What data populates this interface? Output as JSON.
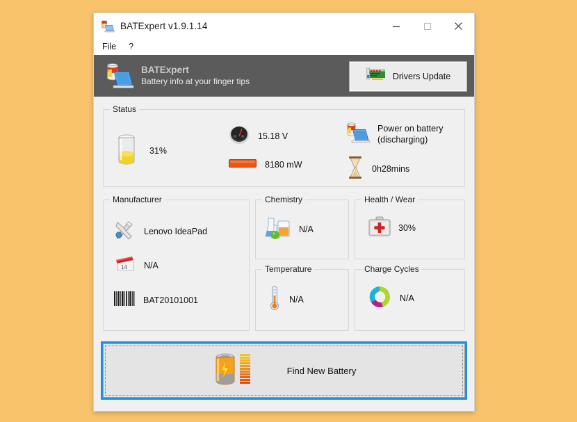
{
  "window": {
    "title": "BATExpert v1.9.1.14",
    "app_icon": "battery-laptop-icon",
    "controls": {
      "minimize": "minimize-icon",
      "maximize": "maximize-icon",
      "close": "close-icon"
    }
  },
  "menu": {
    "items": [
      {
        "label": "File"
      },
      {
        "label": "?"
      }
    ]
  },
  "banner": {
    "icon": "battery-laptop-icon",
    "title": "BATExpert",
    "subtitle": "Battery info at your finger tips",
    "button": {
      "label": "Drivers Update",
      "icon": "pci-card-icon"
    },
    "background": "#5b5b5b"
  },
  "status": {
    "legend": "Status",
    "charge": {
      "icon": "battery-cell-icon",
      "value": "31%"
    },
    "voltage": {
      "icon": "gauge-icon",
      "value": "15.18 V"
    },
    "power": {
      "icon": "orange-bar-icon",
      "value": "8180 mW"
    },
    "power_source": {
      "icon": "laptop-battery-icon",
      "value": "Power on battery\n(discharging)"
    },
    "time_left": {
      "icon": "hourglass-icon",
      "value": "0h28mins"
    }
  },
  "manufacturer": {
    "legend": "Manufacturer",
    "name": {
      "icon": "tools-icon",
      "value": "Lenovo IdeaPad"
    },
    "date": {
      "icon": "calendar-icon",
      "value": "N/A"
    },
    "serial": {
      "icon": "barcode-icon",
      "value": "BAT20101001"
    }
  },
  "chemistry": {
    "legend": "Chemistry",
    "icon": "beakers-icon",
    "value": "N/A"
  },
  "health": {
    "legend": "Health / Wear",
    "icon": "first-aid-kit-icon",
    "value": "30%"
  },
  "temperature": {
    "legend": "Temperature",
    "icon": "thermometer-icon",
    "value": "N/A"
  },
  "cycles": {
    "legend": "Charge Cycles",
    "icon": "recycle-circle-icon",
    "value": "N/A"
  },
  "find_battery": {
    "label": "Find New Battery",
    "icon": "battery-bars-icon"
  },
  "colors": {
    "desktop": "#f9c36c",
    "banner": "#5b5b5b",
    "focus_ring": "#1e90e0",
    "battery_fill": "#f2d22a",
    "power_bar": "#e8541c"
  }
}
